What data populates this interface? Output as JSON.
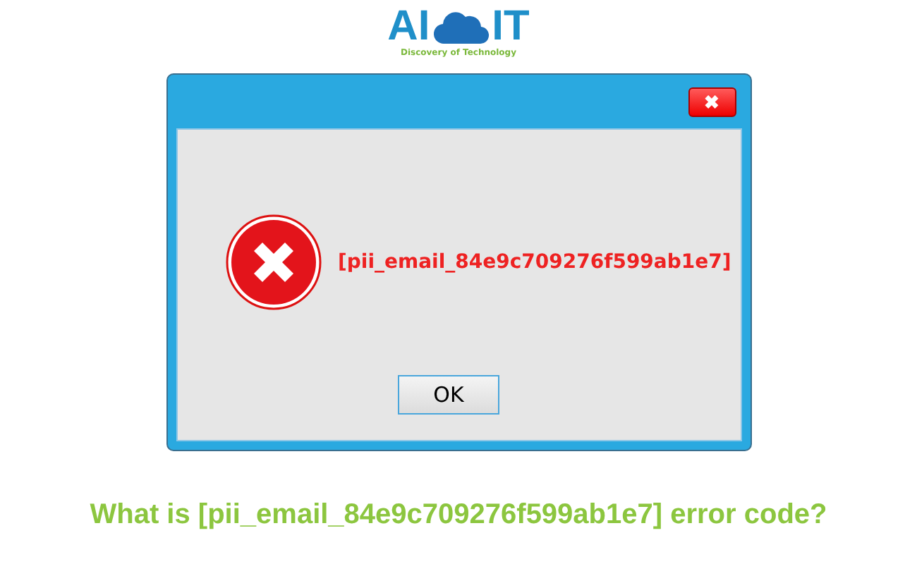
{
  "logo": {
    "left": "AI",
    "right": "IT",
    "tagline": "Discovery of Technology"
  },
  "dialog": {
    "close": "✖",
    "message": "[pii_email_84e9c709276f599ab1e7]",
    "buttons": [
      "OK"
    ]
  },
  "headline": "What is [pii_email_84e9c709276f599ab1e7] error code?"
}
